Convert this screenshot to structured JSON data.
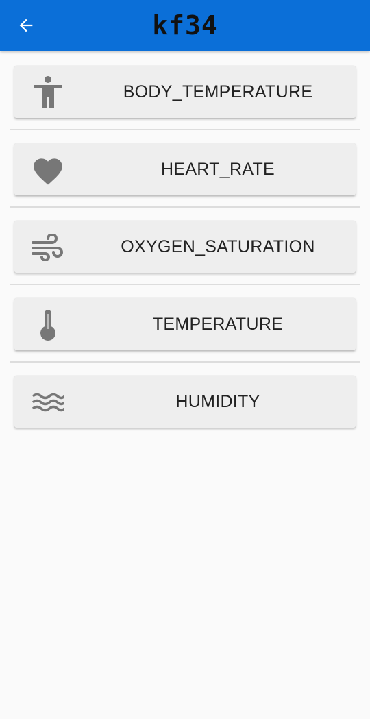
{
  "app_bar": {
    "title": "kf34",
    "background": "#0b6fd8"
  },
  "icons": {
    "back": "arrow-left-icon"
  },
  "sensors": [
    {
      "label": "BODY_TEMPERATURE",
      "icon": "accessibility-person-icon"
    },
    {
      "label": "HEART_RATE",
      "icon": "heart-icon"
    },
    {
      "label": "OXYGEN_SATURATION",
      "icon": "wind-icon"
    },
    {
      "label": "TEMPERATURE",
      "icon": "thermometer-icon"
    },
    {
      "label": "HUMIDITY",
      "icon": "waves-icon"
    }
  ]
}
